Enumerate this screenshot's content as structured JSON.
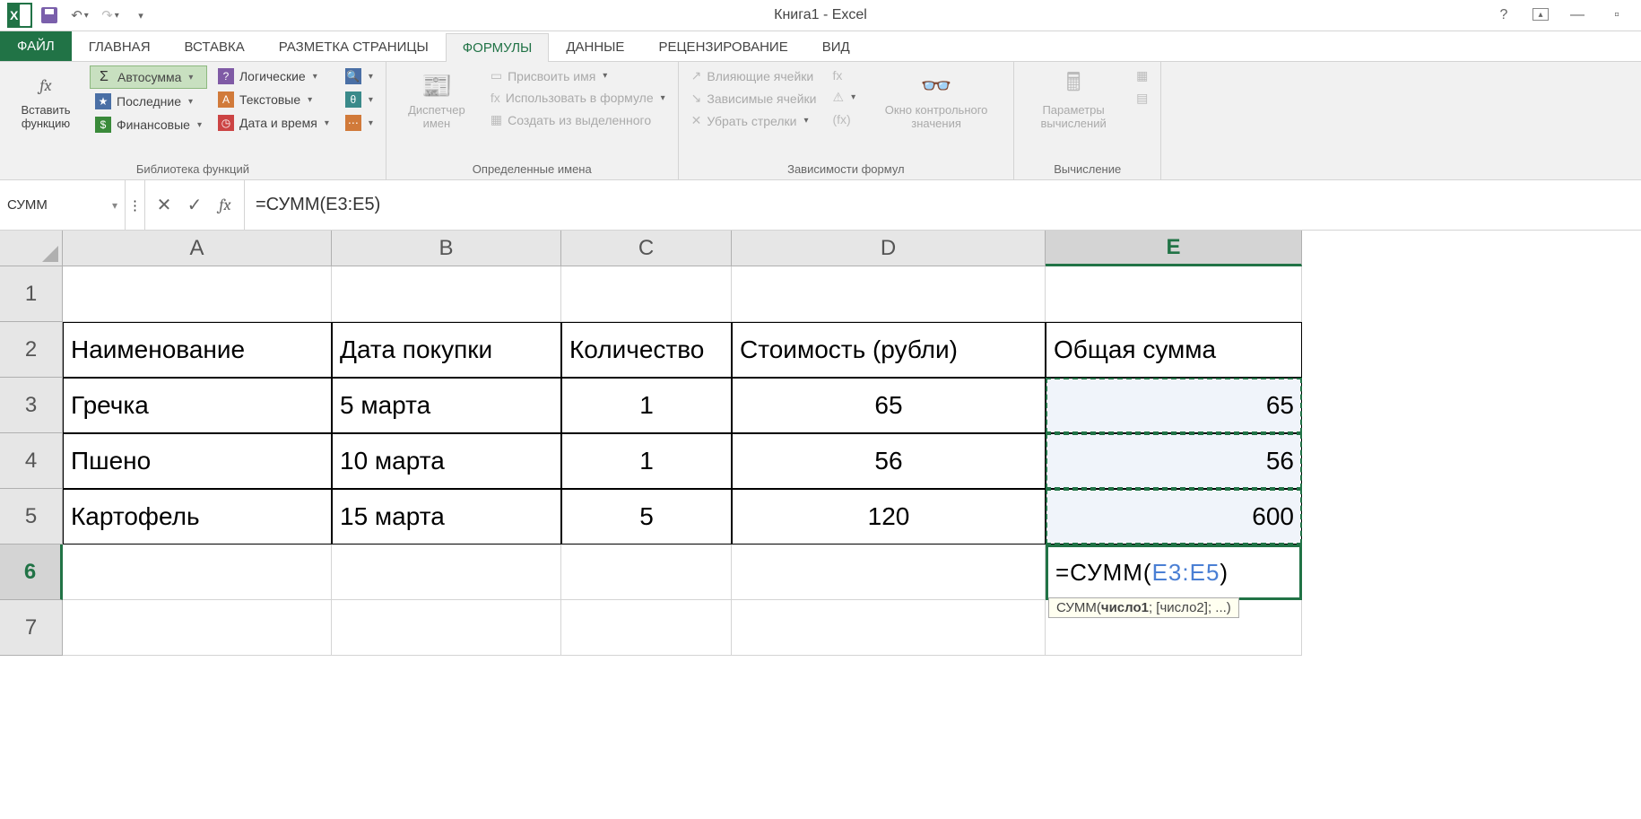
{
  "title": "Книга1 - Excel",
  "qat": {
    "undo_state": "enabled",
    "redo_state": "disabled"
  },
  "tabs": {
    "file": "ФАЙЛ",
    "items": [
      "ГЛАВНАЯ",
      "ВСТАВКА",
      "РАЗМЕТКА СТРАНИЦЫ",
      "ФОРМУЛЫ",
      "ДАННЫЕ",
      "РЕЦЕНЗИРОВАНИЕ",
      "ВИД"
    ],
    "active_index": 3
  },
  "ribbon": {
    "group1": {
      "label": "Библиотека функций",
      "insert_fn": "Вставить функцию",
      "autosum": "Автосумма",
      "recent": "Последние",
      "financial": "Финансовые",
      "logical": "Логические",
      "text": "Текстовые",
      "datetime": "Дата и время"
    },
    "group2": {
      "label": "Определенные имена",
      "name_mgr": "Диспетчер имен",
      "define": "Присвоить имя",
      "use_in": "Использовать в формуле",
      "create_from": "Создать из выделенного"
    },
    "group3": {
      "label": "Зависимости формул",
      "trace_prec": "Влияющие ячейки",
      "trace_dep": "Зависимые ячейки",
      "remove": "Убрать стрелки",
      "watch": "Окно контрольного значения"
    },
    "group4": {
      "label": "Вычисление",
      "calc_opts": "Параметры вычислений"
    }
  },
  "namebox": "СУММ",
  "formula": "=СУММ(E3:E5)",
  "columns": [
    "A",
    "B",
    "C",
    "D",
    "E"
  ],
  "row_numbers": [
    "1",
    "2",
    "3",
    "4",
    "5",
    "6",
    "7"
  ],
  "active_row": "6",
  "active_col": "E",
  "table": {
    "headers": [
      "Наименование",
      "Дата покупки",
      "Количество",
      "Стоимость (рубли)",
      "Общая сумма"
    ],
    "rows": [
      {
        "name": "Гречка",
        "date": "5 марта",
        "qty": "1",
        "cost": "65",
        "sum": "65"
      },
      {
        "name": "Пшено",
        "date": "10 марта",
        "qty": "1",
        "cost": "56",
        "sum": "56"
      },
      {
        "name": "Картофель",
        "date": "15 марта",
        "qty": "5",
        "cost": "120",
        "sum": "600"
      }
    ]
  },
  "editing_cell": {
    "prefix": "=СУММ(",
    "arg": "E3:E5",
    "suffix": ")"
  },
  "tooltip": "СУММ(число1; [число2]; ...)"
}
